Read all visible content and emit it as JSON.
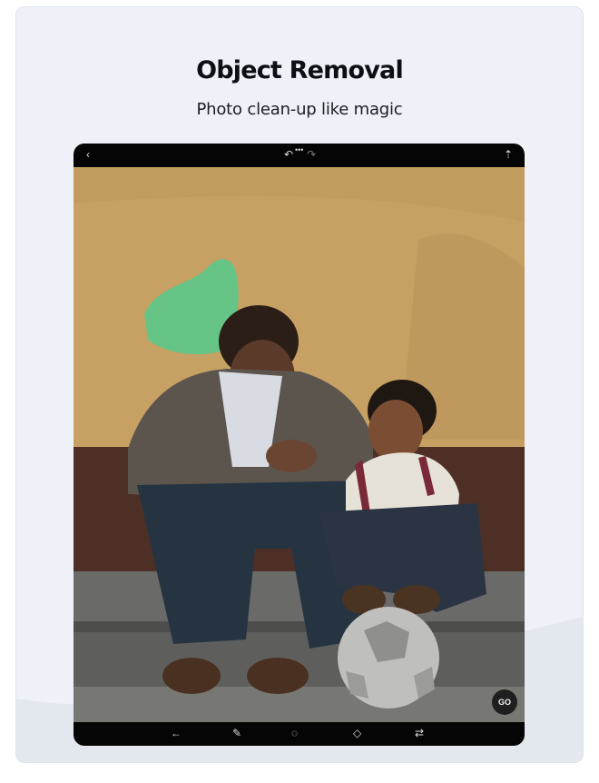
{
  "header": {
    "title": "Object Removal",
    "subtitle": "Photo clean-up like magic"
  },
  "editor": {
    "top_toolbar": {
      "back_icon": "chevron-left-icon",
      "undo_icon": "undo-icon",
      "more_icon": "more-dots-icon",
      "redo_icon": "redo-icon",
      "share_icon": "upload-icon"
    },
    "go_button_label": "GO",
    "bottom_toolbar": {
      "tools": [
        "arrow-left-icon",
        "brush-icon",
        "lasso-icon",
        "eraser-icon",
        "adjust-sliders-icon"
      ]
    }
  },
  "colors": {
    "card_background": "#eef2f8",
    "selection_mask": "#5ac88a",
    "wall": "#c6a062",
    "toolbar": "#050505"
  }
}
